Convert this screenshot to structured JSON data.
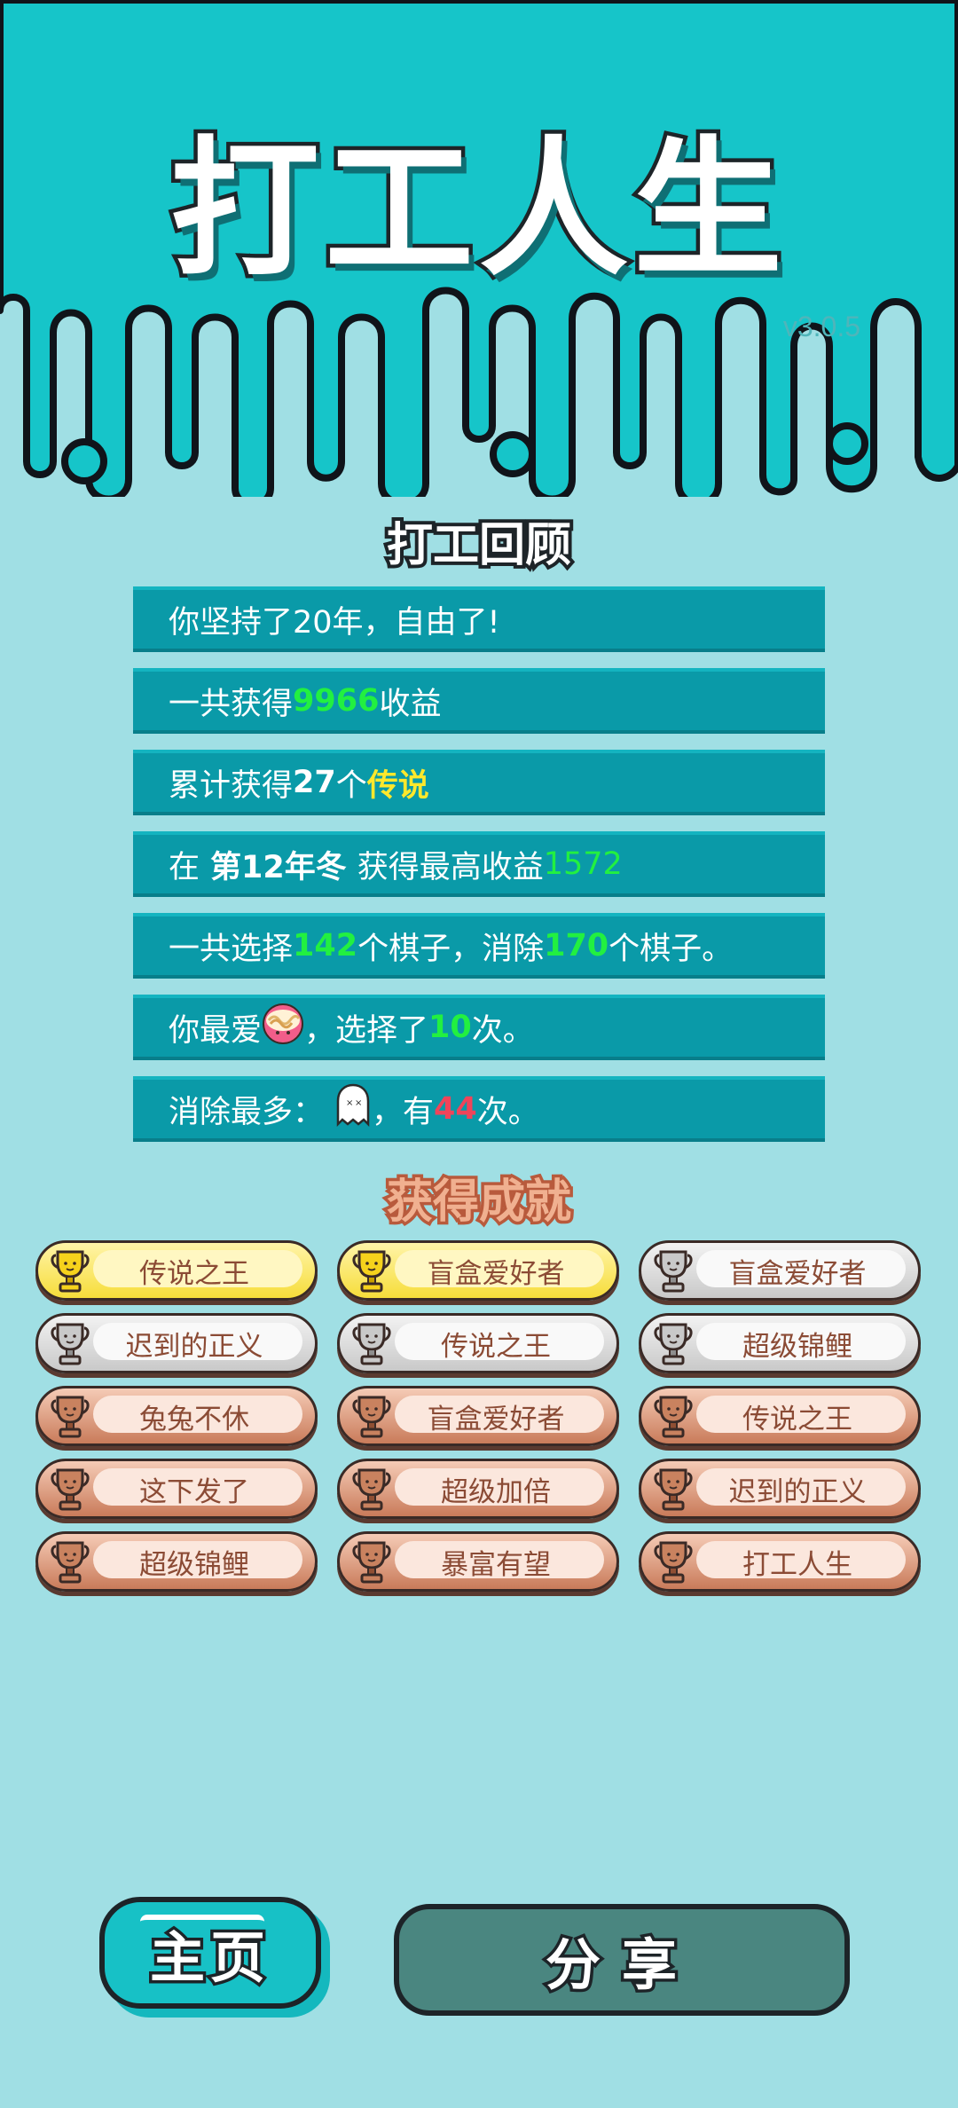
{
  "header": {
    "title": "打工人生",
    "version": "v3.0.5"
  },
  "review": {
    "title": "打工回顾",
    "rows": [
      {
        "parts": [
          "你坚持了20年，自由了!"
        ]
      },
      {
        "parts": [
          "一共获得",
          "9966",
          "收益"
        ]
      },
      {
        "parts": [
          "累计获得",
          "27",
          "个",
          "传说"
        ]
      },
      {
        "parts": [
          "在 ",
          "第12年冬",
          " 获得最高收益",
          "1572"
        ]
      },
      {
        "parts": [
          "一共选择",
          "142",
          "个棋子，消除",
          "170",
          "个棋子。"
        ]
      },
      {
        "parts": [
          "你最爱",
          "，选择了",
          "10",
          "次。"
        ]
      },
      {
        "parts": [
          "消除最多：",
          "，有",
          "44",
          "次。"
        ]
      }
    ]
  },
  "achievements": {
    "title": "获得成就",
    "items": [
      {
        "label": "传说之王",
        "tier": "gold"
      },
      {
        "label": "盲盒爱好者",
        "tier": "gold"
      },
      {
        "label": "盲盒爱好者",
        "tier": "silver"
      },
      {
        "label": "迟到的正义",
        "tier": "silver"
      },
      {
        "label": "传说之王",
        "tier": "silver"
      },
      {
        "label": "超级锦鲤",
        "tier": "silver"
      },
      {
        "label": "兔兔不休",
        "tier": "bronze"
      },
      {
        "label": "盲盒爱好者",
        "tier": "bronze"
      },
      {
        "label": "传说之王",
        "tier": "bronze"
      },
      {
        "label": "这下发了",
        "tier": "bronze"
      },
      {
        "label": "超级加倍",
        "tier": "bronze"
      },
      {
        "label": "迟到的正义",
        "tier": "bronze"
      },
      {
        "label": "超级锦鲤",
        "tier": "bronze"
      },
      {
        "label": "暴富有望",
        "tier": "bronze"
      },
      {
        "label": "打工人生",
        "tier": "bronze"
      }
    ]
  },
  "buttons": {
    "home": "主页",
    "share": "分享"
  },
  "icons": {
    "favorite_piece": "noodle-bowl-icon",
    "most_eliminated": "ghost-icon",
    "achievement": "trophy-icon"
  },
  "colors": {
    "header_bg": "#16c5c9",
    "page_bg": "#a0dfe4",
    "row_bg": "#0a9aa8",
    "highlight_green": "#22f040",
    "highlight_yellow": "#ffe82c",
    "highlight_red": "#f0445a"
  }
}
